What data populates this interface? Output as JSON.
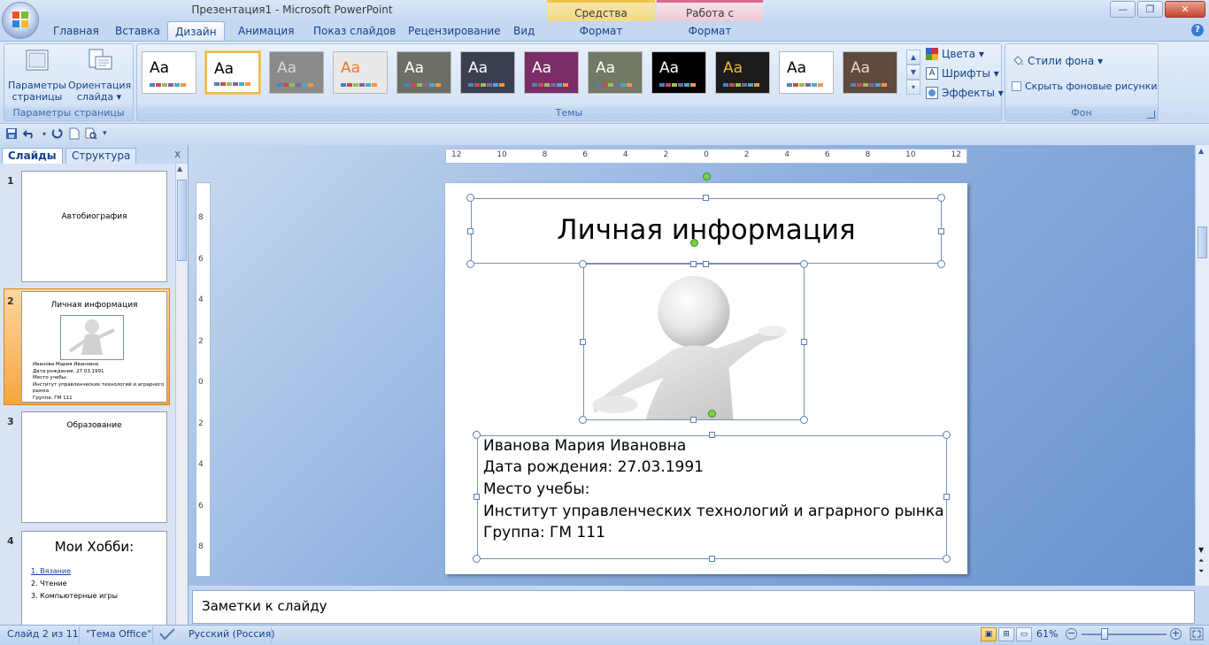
{
  "titlebar": {
    "title": "Презентация1 - Microsoft PowerPoint",
    "context_drawing": "Средства рисования",
    "context_picture": "Работа с рисунками",
    "minimize": "—",
    "restore": "❐",
    "close": "✕"
  },
  "tabs": {
    "home": "Главная",
    "insert": "Вставка",
    "design": "Дизайн",
    "animation": "Анимация",
    "slideshow": "Показ слайдов",
    "review": "Рецензирование",
    "view": "Вид",
    "format1": "Формат",
    "format2": "Формат",
    "help": "?"
  },
  "ribbon": {
    "page_setup": {
      "params_line1": "Параметры",
      "params_line2": "страницы",
      "orient_line1": "Ориентация",
      "orient_line2": "слайда ▾",
      "label": "Параметры страницы"
    },
    "themes": {
      "label": "Темы",
      "sample": "Aa",
      "items": [
        {
          "bg": "#ffffff",
          "fg": "#000000"
        },
        {
          "bg": "#ffffff",
          "fg": "#000000"
        },
        {
          "bg": "#8a8a8a",
          "fg": "#d9d9d9"
        },
        {
          "bg": "#e9e9e9",
          "fg": "#e8762b"
        },
        {
          "bg": "#6c6f66",
          "fg": "#ffffff"
        },
        {
          "bg": "#3b3f52",
          "fg": "#ffffff"
        },
        {
          "bg": "#7a2d66",
          "fg": "#ffffff"
        },
        {
          "bg": "#737a64",
          "fg": "#ffffff"
        },
        {
          "bg": "#000000",
          "fg": "#ffffff"
        },
        {
          "bg": "#1c1c1c",
          "fg": "#f2b735"
        },
        {
          "bg": "#ffffff",
          "fg": "#000000"
        },
        {
          "bg": "#5e4a3e",
          "fg": "#e8d7c5"
        }
      ]
    },
    "options": {
      "colors": "Цвета ▾",
      "fonts": "Шрифты ▾",
      "effects": "Эффекты ▾"
    },
    "background": {
      "styles": "Стили фона ▾",
      "hide": "Скрыть фоновые рисунки",
      "label": "Фон"
    }
  },
  "panes": {
    "slides_tab": "Слайды",
    "outline_tab": "Структура",
    "close": "x"
  },
  "thumbnails": [
    {
      "num": "1",
      "title": "Автобиография"
    },
    {
      "num": "2",
      "title": "Личная информация",
      "lines": [
        "Иванова Мария Ивановна",
        "Дата рождения: 27.03.1991",
        "Место учебы:",
        "Институт управленческих технологий и аграрного рынка",
        "Группа: ГМ 111"
      ]
    },
    {
      "num": "3",
      "title": "Образование"
    },
    {
      "num": "4",
      "title": "Мои Хобби:",
      "items": [
        "1. Вязание",
        "2. Чтение",
        "3. Компьютерные игры"
      ]
    }
  ],
  "slide": {
    "title": "Личная информация",
    "lines": [
      "Иванова Мария Ивановна",
      "Дата рождения: 27.03.1991",
      "Место учебы:",
      "Институт управленческих  технологий и аграрного рынка",
      "Группа: ГМ 111"
    ]
  },
  "ruler": {
    "h_labels": [
      "12",
      "10",
      "8",
      "6",
      "4",
      "2",
      "0",
      "2",
      "4",
      "6",
      "8",
      "10",
      "12"
    ],
    "v_labels": [
      "8",
      "6",
      "4",
      "2",
      "0",
      "2",
      "4",
      "6",
      "8"
    ]
  },
  "notes": {
    "placeholder": "Заметки к слайду"
  },
  "status": {
    "slide": "Слайд 2 из 11",
    "theme": "\"Тема Office\"",
    "language": "Русский (Россия)",
    "zoom": "61%"
  }
}
